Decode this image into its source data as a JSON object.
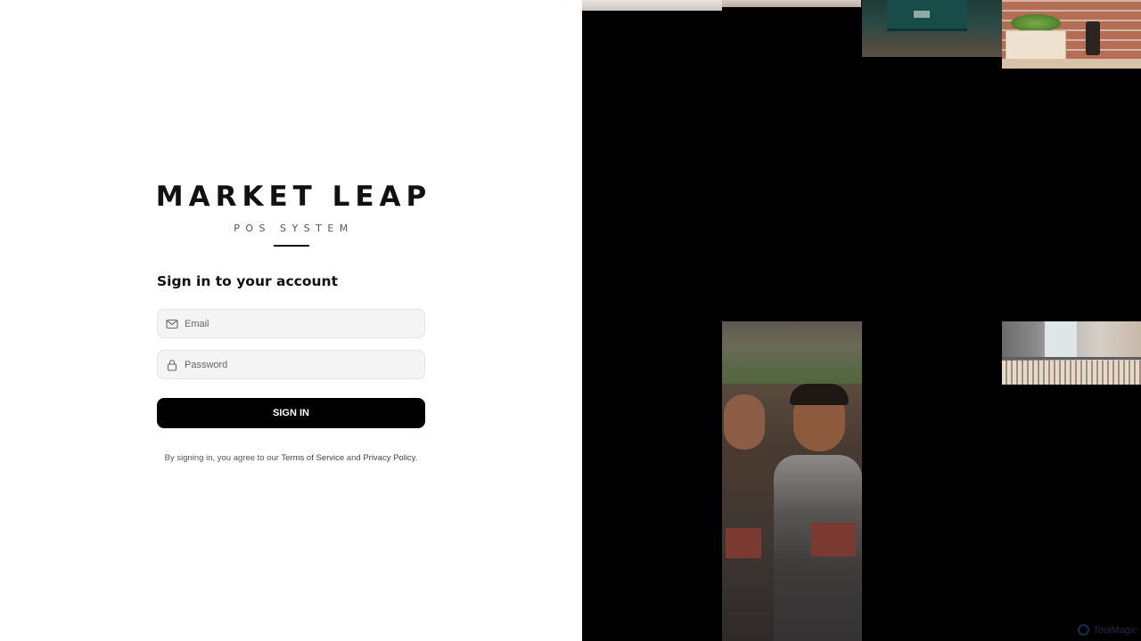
{
  "brand": {
    "title": "MARKET LEAP",
    "subtitle": "POS SYSTEM"
  },
  "signin": {
    "heading": "Sign in to your account",
    "email_placeholder": "Email",
    "password_placeholder": "Password",
    "button_label": "SIGN IN",
    "legal_prefix": "By signing in, you agree to our ",
    "terms_label": "Terms of Service",
    "legal_and": " and ",
    "privacy_label": "Privacy Policy",
    "legal_suffix": "."
  },
  "icons": {
    "email": "mail-icon",
    "password": "lock-icon"
  },
  "gallery": {
    "tiles": [
      "shop-image-1",
      "shop-image-2",
      "shop-image-3",
      "shop-image-4",
      "staff-image",
      "clothing-rack-image"
    ]
  },
  "watermark": {
    "label": "ToolMagic"
  },
  "colors": {
    "primary_button": "#000000",
    "field_background": "#f4f4f4",
    "gallery_background": "#000000"
  }
}
